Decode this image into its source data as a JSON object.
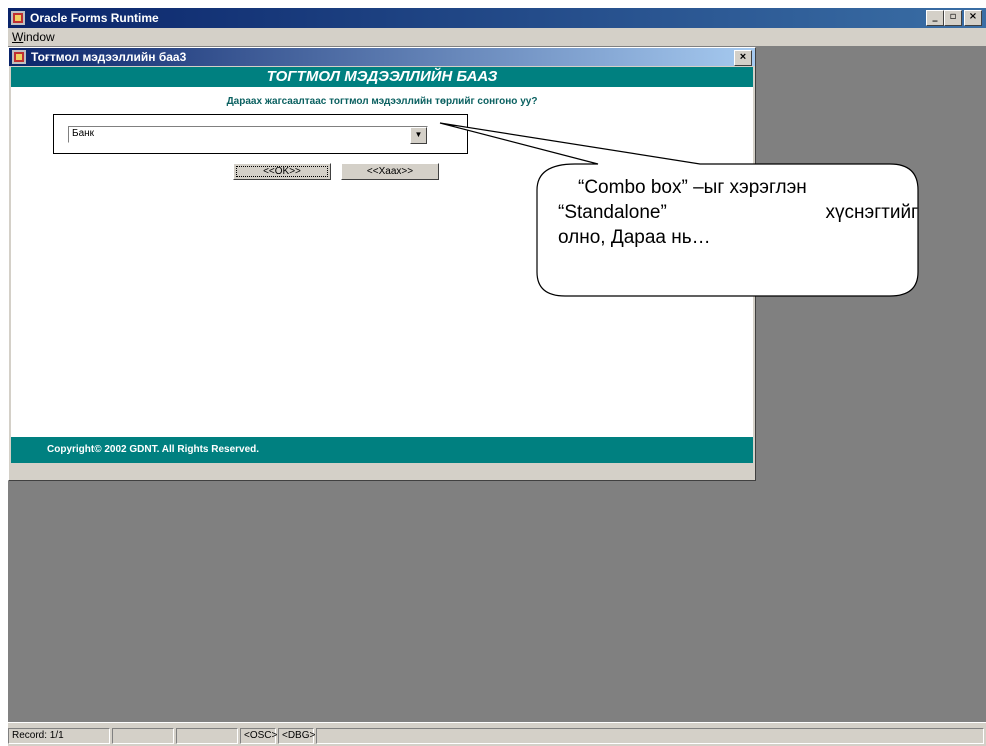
{
  "app": {
    "title": "Oracle Forms Runtime",
    "menu": [
      "Window"
    ],
    "controls": {
      "minimize": "_",
      "restore": "▫",
      "close": "×"
    }
  },
  "form": {
    "title": "Тоғтмол мэдээллийн баа3",
    "close": "×",
    "banner": "ТОГТМОЛ МЭДЭЭЛЛИЙН БААЗ",
    "prompt": "Дараах жагсаалтаас тогтмол мэдээллийн төрлийг сонгоно уу?",
    "combo": {
      "value": "Банк",
      "arrow": "▼"
    },
    "ok_label": "<<OK>>",
    "exit_label": "<<Хаах>>",
    "footer": "Copyright© 2002 GDNT. All Rights Reserved."
  },
  "statusbar": {
    "record": "Record: 1/1",
    "osc": "<OSC>",
    "dbg": "<DBG>"
  },
  "callout": {
    "line1": "“Combo box” –ыг хэрэглэн",
    "line2a": "“Standalone”",
    "line2b": "хүснэгтийг",
    "line3": "олно, Дараа нь…"
  },
  "colors": {
    "teal": "#008080",
    "title_blue": "#0a246a",
    "mdi_gray": "#808080"
  },
  "icons": [
    "app-icon",
    "form-icon"
  ]
}
